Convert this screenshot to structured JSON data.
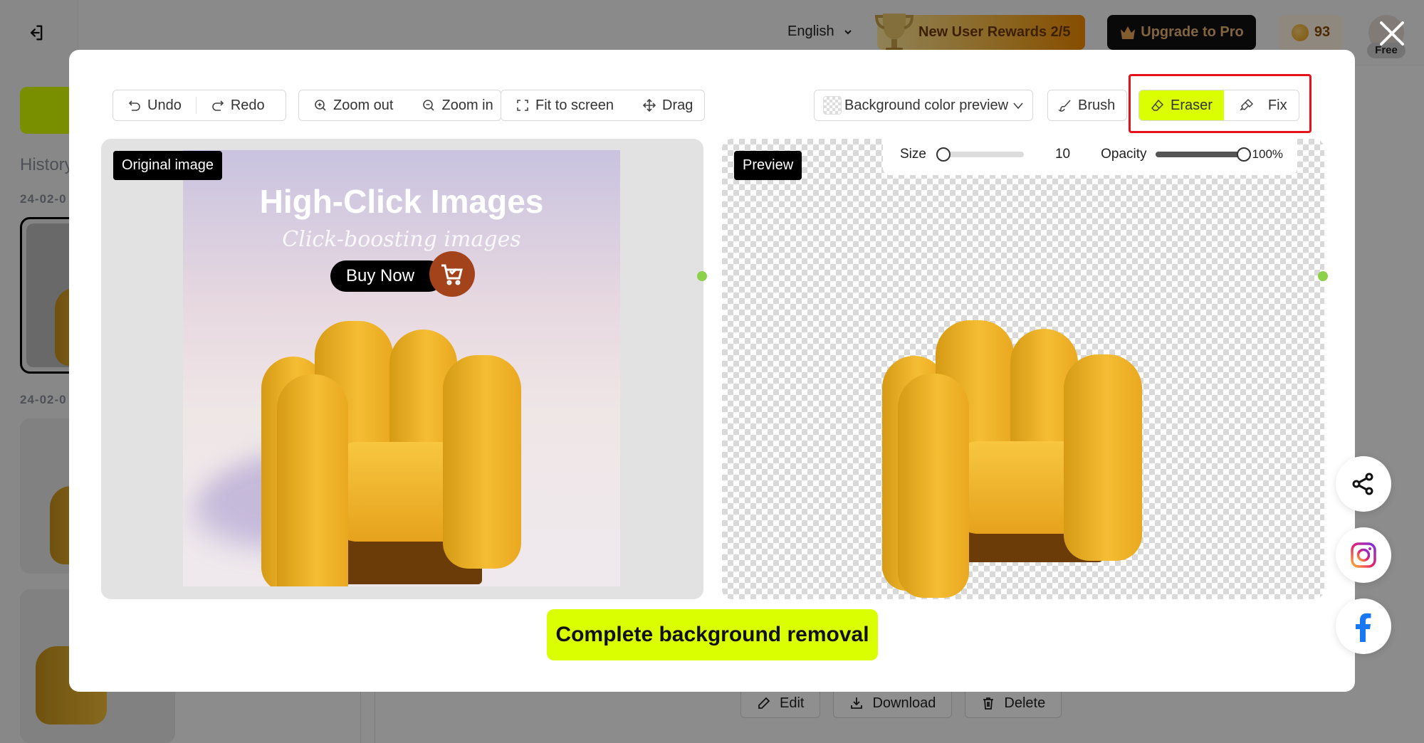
{
  "header": {
    "language": "English",
    "rewards_label": "New User Rewards 2/5",
    "upgrade_label": "Upgrade to Pro",
    "credits": "93",
    "plan_badge": "Free"
  },
  "sidebar": {
    "history_label": "History",
    "dates": [
      "24-02-0",
      "24-02-0"
    ]
  },
  "background_actions": {
    "edit": "Edit",
    "download": "Download",
    "delete": "Delete"
  },
  "modal": {
    "toolbar": {
      "undo": "Undo",
      "redo": "Redo",
      "zoom_out": "Zoom out",
      "zoom_in": "Zoom in",
      "fit_to_screen": "Fit to screen",
      "drag": "Drag",
      "bg_preview": "Background color preview",
      "brush": "Brush",
      "eraser": "Eraser",
      "fix": "Fix",
      "active_tool": "Eraser"
    },
    "brush_settings": {
      "size_label": "Size",
      "size_value": "10",
      "size_fraction": 0.0,
      "opacity_label": "Opacity",
      "opacity_value": "100%",
      "opacity_fraction": 1.0
    },
    "original_tag": "Original image",
    "preview_tag": "Preview",
    "ad": {
      "title": "High-Click Images",
      "subtitle": "Click-boosting images",
      "button": "Buy Now"
    },
    "complete_button": "Complete background removal"
  },
  "colors": {
    "accent": "#d9ff00",
    "highlight": "#e6121b",
    "upgrade_bg": "#111111",
    "upgrade_text": "#e8b273"
  },
  "social": [
    "share-icon",
    "instagram-icon",
    "facebook-icon"
  ]
}
